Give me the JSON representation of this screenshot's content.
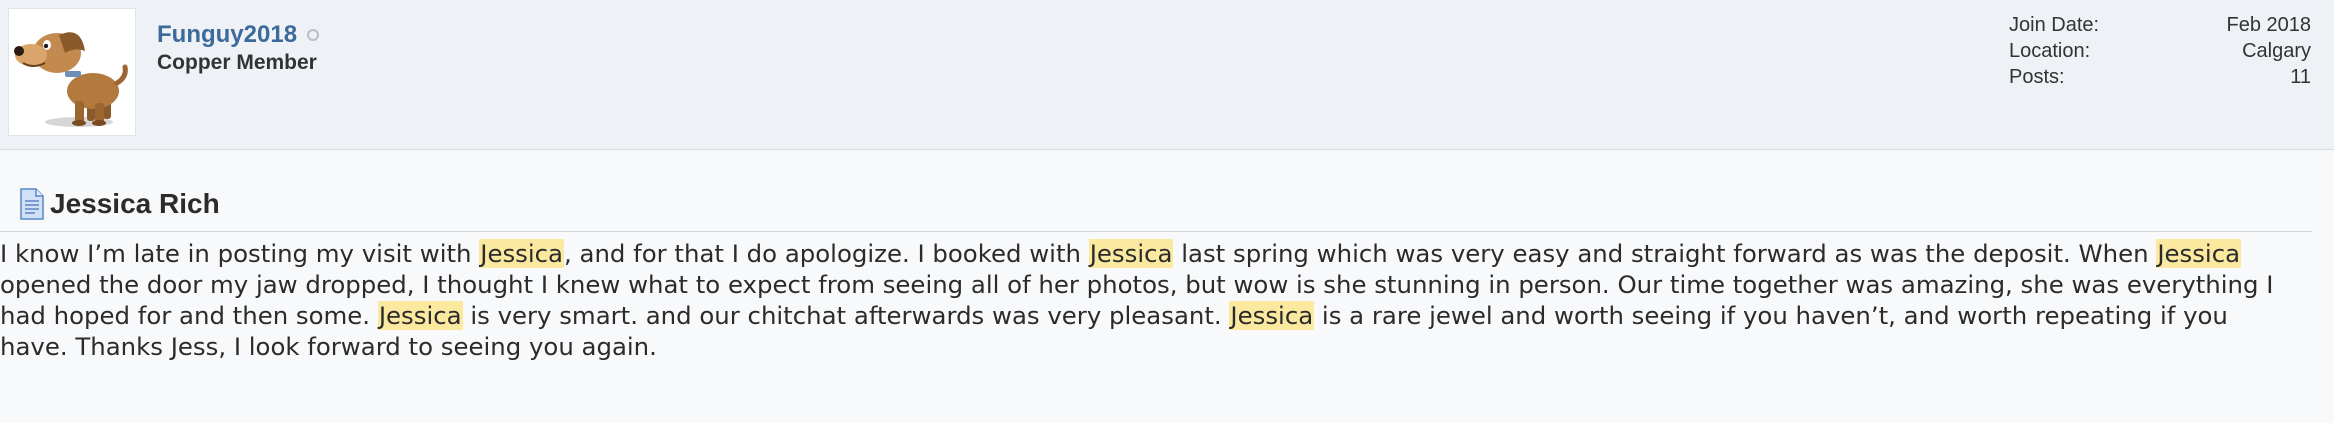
{
  "user": {
    "username": "Funguy2018",
    "title": "Copper Member",
    "avatar_icon": "dog-cartoon-avatar",
    "online_status": "offline",
    "stats": [
      {
        "label": "Join Date:",
        "value": "Feb 2018"
      },
      {
        "label": "Location:",
        "value": "Calgary"
      },
      {
        "label": "Posts:",
        "value": "11"
      }
    ]
  },
  "post": {
    "title_icon": "document-icon",
    "title": "Jessica Rich",
    "highlight_term": "Jessica",
    "highlight_color": "#fbe9a0",
    "body": {
      "s1": "I know I’m late in posting my visit with ",
      "h1": "Jessica",
      "s2": ", and for that I do apologize. I booked with ",
      "h2": "Jessica",
      "s3": " last spring which was very easy and straight forward as was the deposit. When ",
      "h3": "Jessica",
      "s4": " opened the door my jaw dropped, I thought I knew what to expect from seeing all of her photos, but wow is she stunning in person. Our time together was amazing, she was everything I had hoped for and then some. ",
      "h4": "Jessica",
      "s5": " is very smart. and our chitchat afterwards was very pleasant. ",
      "h5": "Jessica",
      "s6": " is a rare jewel and worth seeing if you haven’t, and worth repeating if you have. Thanks Jess, I look forward to seeing you again."
    }
  }
}
